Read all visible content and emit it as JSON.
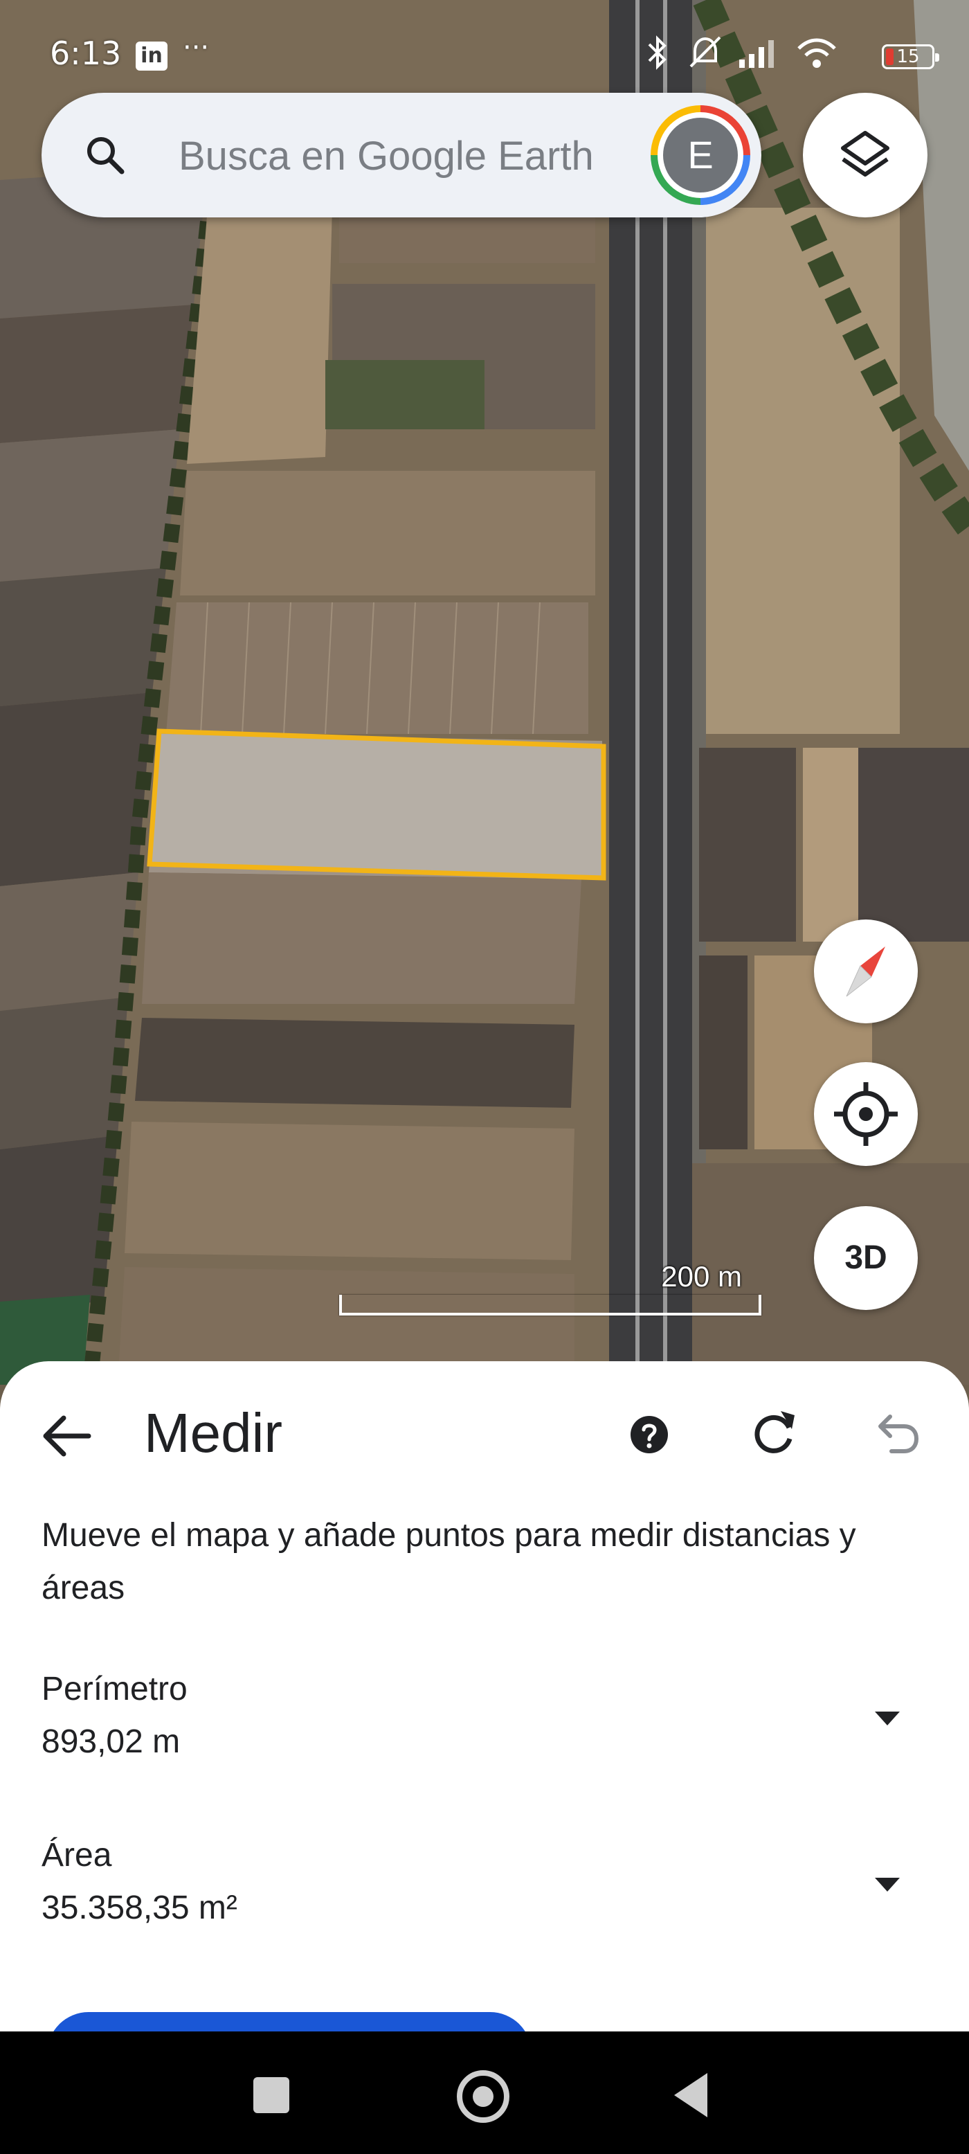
{
  "status_bar": {
    "time": "6:13",
    "app_badge": "in",
    "more": "···",
    "battery_level": "15"
  },
  "search": {
    "placeholder": "Busca en Google Earth",
    "avatar_initial": "E"
  },
  "map": {
    "scale_label": "200 m",
    "three_d_label": "3D",
    "highlight_color": "#f2b417"
  },
  "measure_panel": {
    "title": "Medir",
    "description": "Mueve el mapa y añade puntos para medir distancias y áreas",
    "perimeter": {
      "label": "Perímetro",
      "value": "893,02 m"
    },
    "area": {
      "label": "Área",
      "value": "35.358,35 m²"
    }
  },
  "colors": {
    "accent_blue": "#1a57d6",
    "battery_low": "#e03c31"
  },
  "icons": {
    "search": "search-icon",
    "layers": "layers-icon",
    "compass": "compass-icon",
    "location": "my-location-icon",
    "back": "arrow-back-icon",
    "help": "help-icon",
    "refresh": "refresh-icon",
    "undo": "undo-icon"
  }
}
